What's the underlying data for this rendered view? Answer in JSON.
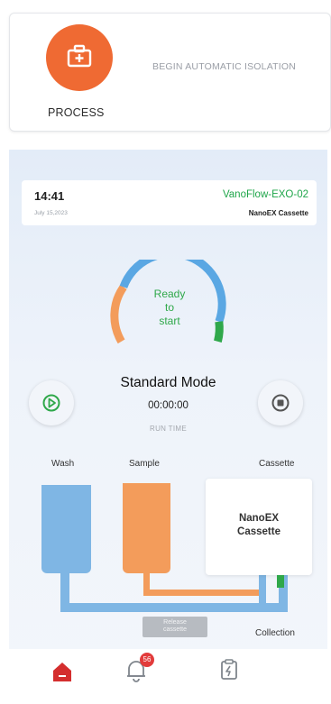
{
  "top_card": {
    "process_label": "PROCESS",
    "begin_label": "BEGIN AUTOMATIC ISOLATION",
    "icon": "first-aid-kit-icon",
    "accent": "#ef6a33"
  },
  "status": {
    "time": "14:41",
    "device_name": "VanoFlow-EXO-02",
    "date": "July 15,2023",
    "cassette_type": "NanoEX Cassette"
  },
  "gauge": {
    "text_line1": "Ready",
    "text_line2": "to",
    "text_line3": "start",
    "colors": {
      "blue": "#5aa7e3",
      "orange": "#f39c5b",
      "green": "#2fa84a"
    }
  },
  "controls": {
    "play_icon": "play-icon",
    "stop_icon": "stop-icon",
    "mode": "Standard Mode",
    "timer": "00:00:00",
    "run_time_label": "RUN TIME"
  },
  "flow": {
    "wash_label": "Wash",
    "sample_label": "Sample",
    "cassette_label": "Cassette",
    "cassette_line1": "NanoEX",
    "cassette_line2": "Cassette",
    "release_line1": "Release",
    "release_line2": "cassette",
    "collection_label": "Collection"
  },
  "nav": {
    "home_icon": "home-icon",
    "bell_icon": "bell-icon",
    "notification_count": "56",
    "report_icon": "report-icon"
  }
}
